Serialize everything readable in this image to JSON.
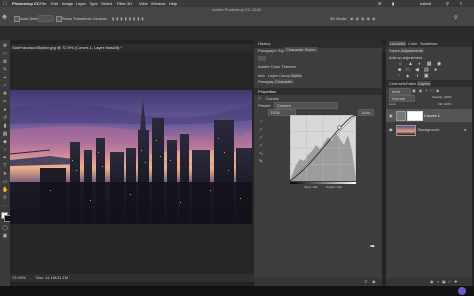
{
  "menubar": {
    "apple": "",
    "app": "Photoshop CC",
    "items": [
      "File",
      "Edit",
      "Image",
      "Layer",
      "Type",
      "Select",
      "Filter 3D",
      "View",
      "Window",
      "Help"
    ],
    "window_title": "Adobe Photoshop CC 2018",
    "user": "hakett"
  },
  "optionsbar": {
    "auto_select": "Auto-Select:",
    "show_transform": "Show Transform Controls",
    "workspace": "3D Mode:"
  },
  "document": {
    "tab_label": "SanFranciscoSkyline.jpg @ 72.9% (Curves 1, Layer Mask/8) *",
    "status_zoom": "72.93%",
    "status_doc": "Doc: 11.1M/11.1M"
  },
  "midpanel": {
    "tabs_top": [
      "History"
    ],
    "tabs_char": [
      "Paragraph Styles",
      "Character Styles"
    ],
    "swatch_label": "Adobe Color Themes",
    "sub_tabs": [
      "Info",
      "Layer Comps",
      "Notes"
    ],
    "char_tabs": [
      "Paragraph",
      "Character"
    ],
    "properties_title": "Properties",
    "curves_label": "Curves",
    "preset_label": "Preset:",
    "preset_value": "Custom",
    "channel_value": "RGB",
    "auto_label": "Auto",
    "input_label": "Input: 199",
    "output_label": "Output: 194"
  },
  "rightpanel": {
    "tabs": [
      "Libraries",
      "Color",
      "Swatches"
    ],
    "adj_tabs": [
      "Styles",
      "Adjustments"
    ],
    "adj_hint": "Add an adjustment",
    "layer_tabs": [
      "Channels",
      "Paths",
      "Layers"
    ],
    "kind": "Kind",
    "blend": "Normal",
    "opacity": "Opacity: 100%",
    "fill": "Fill: 100%",
    "lock": "Lock:",
    "layers": [
      {
        "name": "Curves 1",
        "type": "adjustment"
      },
      {
        "name": "Background",
        "type": "image"
      }
    ]
  },
  "colors": {
    "panel": "#3d3d3d",
    "accent": "#2d8ceb",
    "sky_top": "#5a4b8f",
    "sky_glow": "#e7a07a"
  }
}
